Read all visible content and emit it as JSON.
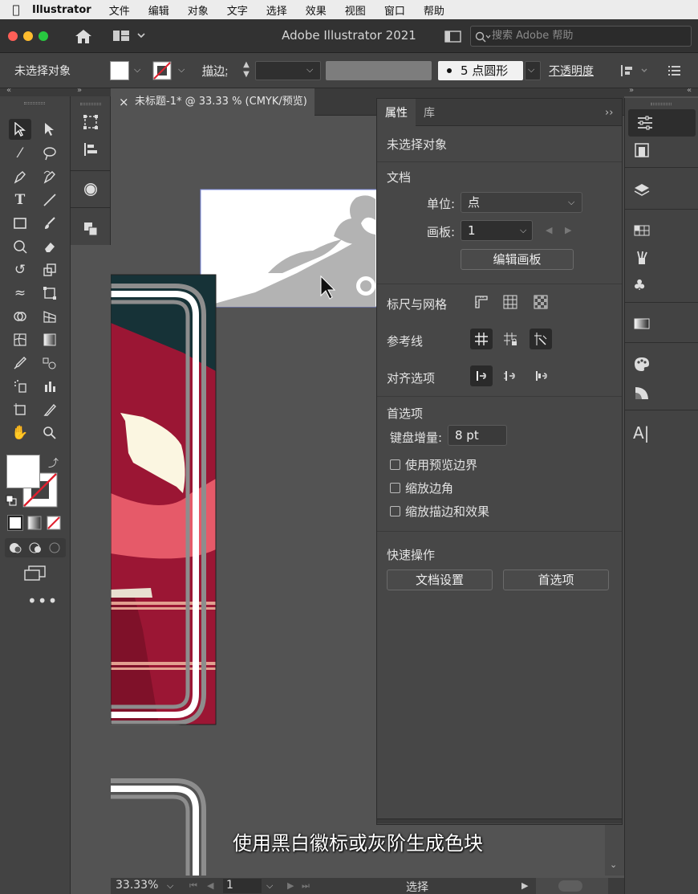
{
  "menubar": {
    "app": "Illustrator",
    "items": [
      "文件",
      "编辑",
      "对象",
      "文字",
      "选择",
      "效果",
      "视图",
      "窗口",
      "帮助"
    ]
  },
  "titlebar": {
    "title": "Adobe Illustrator 2021",
    "search_placeholder": "搜索 Adobe 帮助"
  },
  "controlbar": {
    "selection_label": "未选择对象",
    "stroke_label": "描边:",
    "brush_label": "5 点圆形",
    "opacity_label": "不透明度"
  },
  "document_tab": {
    "title": "未标题-1* @ 33.33 % (CMYK/预览)",
    "close": "×"
  },
  "properties": {
    "tabs": [
      "属性",
      "库"
    ],
    "collapse": "››",
    "no_selection": "未选择对象",
    "document": {
      "heading": "文档",
      "units_label": "单位:",
      "units_value": "点",
      "artboard_label": "画板:",
      "artboard_value": "1",
      "edit_artboards": "编辑画板"
    },
    "rulers_grids": "标尺与网格",
    "guides": "参考线",
    "snap_options": "对齐选项",
    "preferences": {
      "heading": "首选项",
      "keyboard_increment_label": "键盘增量:",
      "keyboard_increment_value": "8 pt",
      "checkboxes": [
        "使用预览边界",
        "缩放边角",
        "缩放描边和效果"
      ]
    },
    "quick_actions": {
      "heading": "快速操作",
      "buttons": [
        "文档设置",
        "首选项"
      ]
    }
  },
  "statusbar": {
    "zoom": "33.33%",
    "artboard": "1",
    "tool": "选择"
  },
  "subtitle": "使用黑白徽标或灰阶生成色块",
  "colors": {
    "accent_red": "#9b1634",
    "dark_teal": "#163237",
    "cream": "#fbf6e1",
    "pink": "#e65a69",
    "ornament_gray": "#b3b3b3"
  }
}
